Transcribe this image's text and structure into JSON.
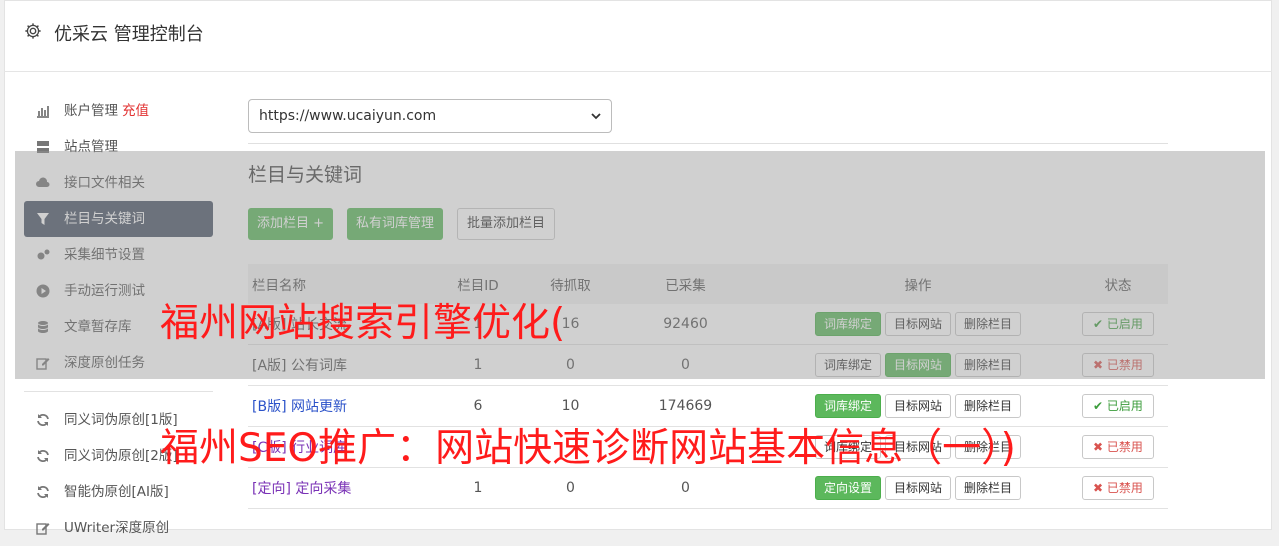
{
  "header": {
    "title": "优采云 管理控制台",
    "icon": "gear-icon"
  },
  "sidebar": {
    "items": [
      {
        "label": "账户管理",
        "extra": "充值",
        "icon": "bar-chart-icon"
      },
      {
        "label": "站点管理",
        "icon": "server-icon"
      },
      {
        "label": "接口文件相关",
        "icon": "cloud-upload-icon"
      },
      {
        "label": "栏目与关键词",
        "icon": "filter-icon"
      },
      {
        "label": "采集细节设置",
        "icon": "cogs-icon"
      },
      {
        "label": "手动运行测试",
        "icon": "play-circle-icon"
      },
      {
        "label": "文章暂存库",
        "icon": "database-icon"
      },
      {
        "label": "深度原创任务",
        "icon": "edit-icon"
      }
    ],
    "items2": [
      {
        "label": "同义词伪原创[1版]",
        "icon": "refresh-icon"
      },
      {
        "label": "同义词伪原创[2版]",
        "icon": "refresh-icon"
      },
      {
        "label": "智能伪原创[AI版]",
        "icon": "refresh-icon"
      },
      {
        "label": "UWriter深度原创",
        "icon": "edit-icon"
      }
    ]
  },
  "main": {
    "site_select": "https://www.ucaiyun.com",
    "section_title": "栏目与关键词",
    "buttons": {
      "add": "添加栏目 +",
      "private": "私有词库管理",
      "batch": "批量添加栏目"
    },
    "table": {
      "headers": [
        "栏目名称",
        "栏目ID",
        "待抓取",
        "已采集",
        "操作",
        "状态"
      ],
      "rows": [
        {
          "name": "[A版] 站长交流",
          "id": "1",
          "pending": "16",
          "collected": "92460",
          "op1": "词库绑定",
          "op2": "目标网站",
          "op3": "删除栏目",
          "status": "已启用"
        },
        {
          "name": "[A版] 公有词库",
          "id": "1",
          "pending": "0",
          "collected": "0",
          "op1": "词库绑定",
          "op2": "目标网站",
          "op3": "删除栏目",
          "status": "已禁用"
        },
        {
          "name": "[B版] 网站更新",
          "id": "6",
          "pending": "10",
          "collected": "174669",
          "op1": "词库绑定",
          "op2": "目标网站",
          "op3": "删除栏目",
          "status": "已启用"
        },
        {
          "name": "[C版] 行业词库",
          "id": "",
          "pending": "",
          "collected": "",
          "op1": "词库绑定",
          "op2": "目标网站",
          "op3": "删除栏目",
          "status": "已禁用"
        },
        {
          "name": "[定向] 定向采集",
          "id": "1",
          "pending": "0",
          "collected": "0",
          "op1": "定向设置",
          "op2": "目标网站",
          "op3": "删除栏目",
          "status": "已禁用"
        }
      ]
    }
  },
  "watermark": {
    "line1": "福州网站搜索引擎优化(",
    "line2": "福州SEO推广：网站快速诊断网站基本信息（一）)"
  },
  "colors": {
    "green": "#5cb85c",
    "sidebar_active": "#4a5567",
    "red": "#d9534f",
    "watermark": "#ff1b1b"
  }
}
